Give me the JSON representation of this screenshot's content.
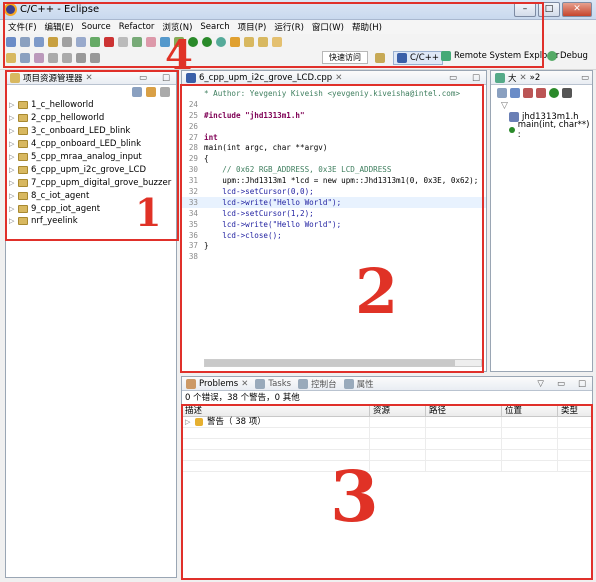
{
  "window": {
    "title": "C/C++ - Eclipse",
    "min": "–",
    "max": "□",
    "close": "✕"
  },
  "menu": [
    "文件(F)",
    "编辑(E)",
    "Source",
    "Refactor",
    "浏览(N)",
    "Search",
    "项目(P)",
    "运行(R)",
    "窗口(W)",
    "帮助(H)"
  ],
  "toolbar": {
    "quick_access": "快速访问",
    "perspectives": [
      "C/C++",
      "Remote System Explorer",
      "Debug"
    ]
  },
  "project_explorer": {
    "title": "项目资源管理器",
    "items": [
      "1_c_helloworld",
      "2_cpp_helloworld",
      "3_c_onboard_LED_blink",
      "4_cpp_onboard_LED_blink",
      "5_cpp_mraa_analog_input",
      "6_cpp_upm_i2c_grove_LCD",
      "7_cpp_upm_digital_grove_buzzer",
      "8_c_iot_agent",
      "9_cpp_iot_agent",
      "nrf_yeelink"
    ]
  },
  "editor": {
    "tab": "6_cpp_upm_i2c_grove_LCD.cpp",
    "lines": [
      {
        "n": "",
        "t": "* Author: Yevgeniy Kiveish <yevgeniy.kiveisha@intel.com>"
      },
      {
        "n": "24",
        "t": ""
      },
      {
        "n": "25",
        "t": "#include \"jhd1313m1.h\""
      },
      {
        "n": "26",
        "t": ""
      },
      {
        "n": "27",
        "t": "int"
      },
      {
        "n": "28",
        "t": "main(int argc, char **argv)"
      },
      {
        "n": "29",
        "t": "{"
      },
      {
        "n": "30",
        "t": "    // 0x62 RGB_ADDRESS, 0x3E LCD_ADDRESS"
      },
      {
        "n": "31",
        "t": "    upm::Jhd1313m1 *lcd = new upm::Jhd1313m1(0, 0x3E, 0x62);"
      },
      {
        "n": "32",
        "t": "    lcd->setCursor(0,0);"
      },
      {
        "n": "33",
        "t": "    lcd->write(\"Hello World\");"
      },
      {
        "n": "34",
        "t": "    lcd->setCursor(1,2);"
      },
      {
        "n": "35",
        "t": "    lcd->write(\"Hello World\");"
      },
      {
        "n": "36",
        "t": "    lcd->close();"
      },
      {
        "n": "37",
        "t": "}"
      },
      {
        "n": "38",
        "t": ""
      }
    ]
  },
  "outline": {
    "tab1": "大",
    "tab2": "»2",
    "items": [
      "jhd1313m1.h",
      "main(int, char**) :"
    ]
  },
  "problems": {
    "tabs": [
      "Problems",
      "Tasks",
      "控制台",
      "属性"
    ],
    "summary": "0 个错误，38 个警告，0 其他",
    "columns": [
      "描述",
      "资源",
      "路径",
      "位置",
      "类型"
    ],
    "row": "警告（ 38 项）"
  },
  "annotations": [
    "1",
    "2",
    "3",
    "4"
  ],
  "colors": {
    "annotation": "#e03226",
    "keyword": "#7f0055",
    "string": "#2a00ff",
    "comment": "#3f7f5f"
  }
}
